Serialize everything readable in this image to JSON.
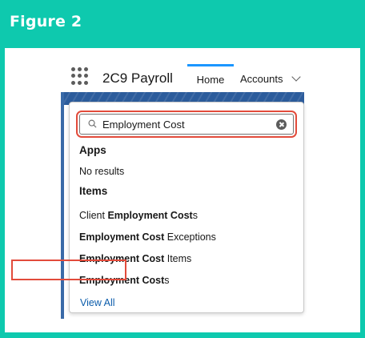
{
  "figure": {
    "title": "Figure 2"
  },
  "header": {
    "app_name": "2C9 Payroll",
    "tabs": [
      {
        "label": "Home",
        "active": true
      },
      {
        "label": "Accounts",
        "active": false
      }
    ]
  },
  "search": {
    "value": "Employment Cost",
    "query_bold": "Employment Cost"
  },
  "results": {
    "apps_heading": "Apps",
    "apps_empty": "No results",
    "items_heading": "Items",
    "items": [
      {
        "prefix": "Client ",
        "bold": "Employment Cost",
        "suffix": "s"
      },
      {
        "prefix": "",
        "bold": "Employment Cost",
        "suffix": " Exceptions"
      },
      {
        "prefix": "",
        "bold": "Employment Cost",
        "suffix": " Items"
      },
      {
        "prefix": "",
        "bold": "Employment Cost",
        "suffix": "s"
      }
    ],
    "view_all": "View All"
  },
  "colors": {
    "frame": "#0ec9ae",
    "highlight": "#e24b3b",
    "active_tab": "#1b96ff",
    "link": "#0b5cab"
  }
}
